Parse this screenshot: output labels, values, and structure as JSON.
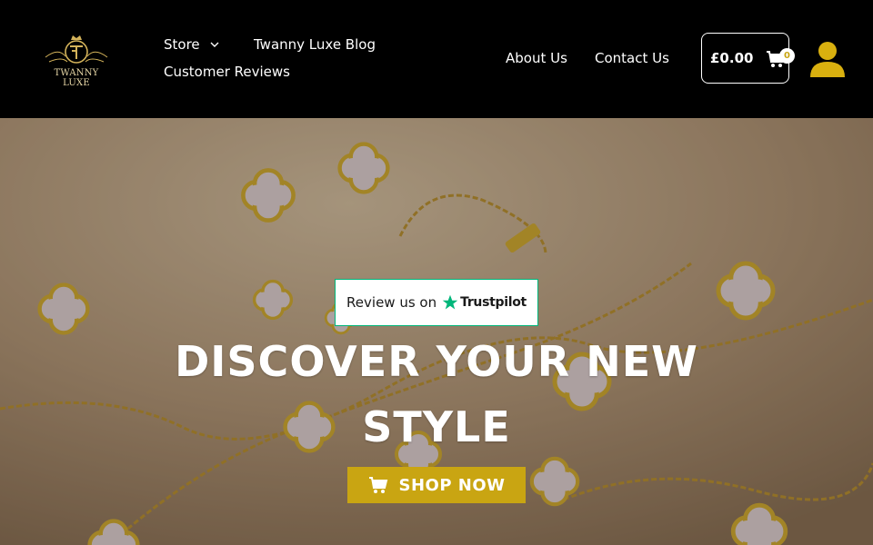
{
  "brand": {
    "logo_text": "TWANNY LUXE",
    "accent_color": "#c9a512"
  },
  "nav": {
    "store_label": "Store",
    "blog_label": "Twanny Luxe Blog",
    "reviews_label": "Customer Reviews",
    "about_label": "About Us",
    "contact_label": "Contact Us"
  },
  "cart": {
    "total": "£0.00",
    "count": "0",
    "icon": "shopping-cart-icon"
  },
  "account": {
    "icon": "user-icon"
  },
  "hero": {
    "review_prefix": "Review us on",
    "review_brand": "Trustpilot",
    "headline_line1": "DISCOVER YOUR NEW",
    "headline_line2": "STYLE",
    "cta_label": "SHOP NOW"
  }
}
